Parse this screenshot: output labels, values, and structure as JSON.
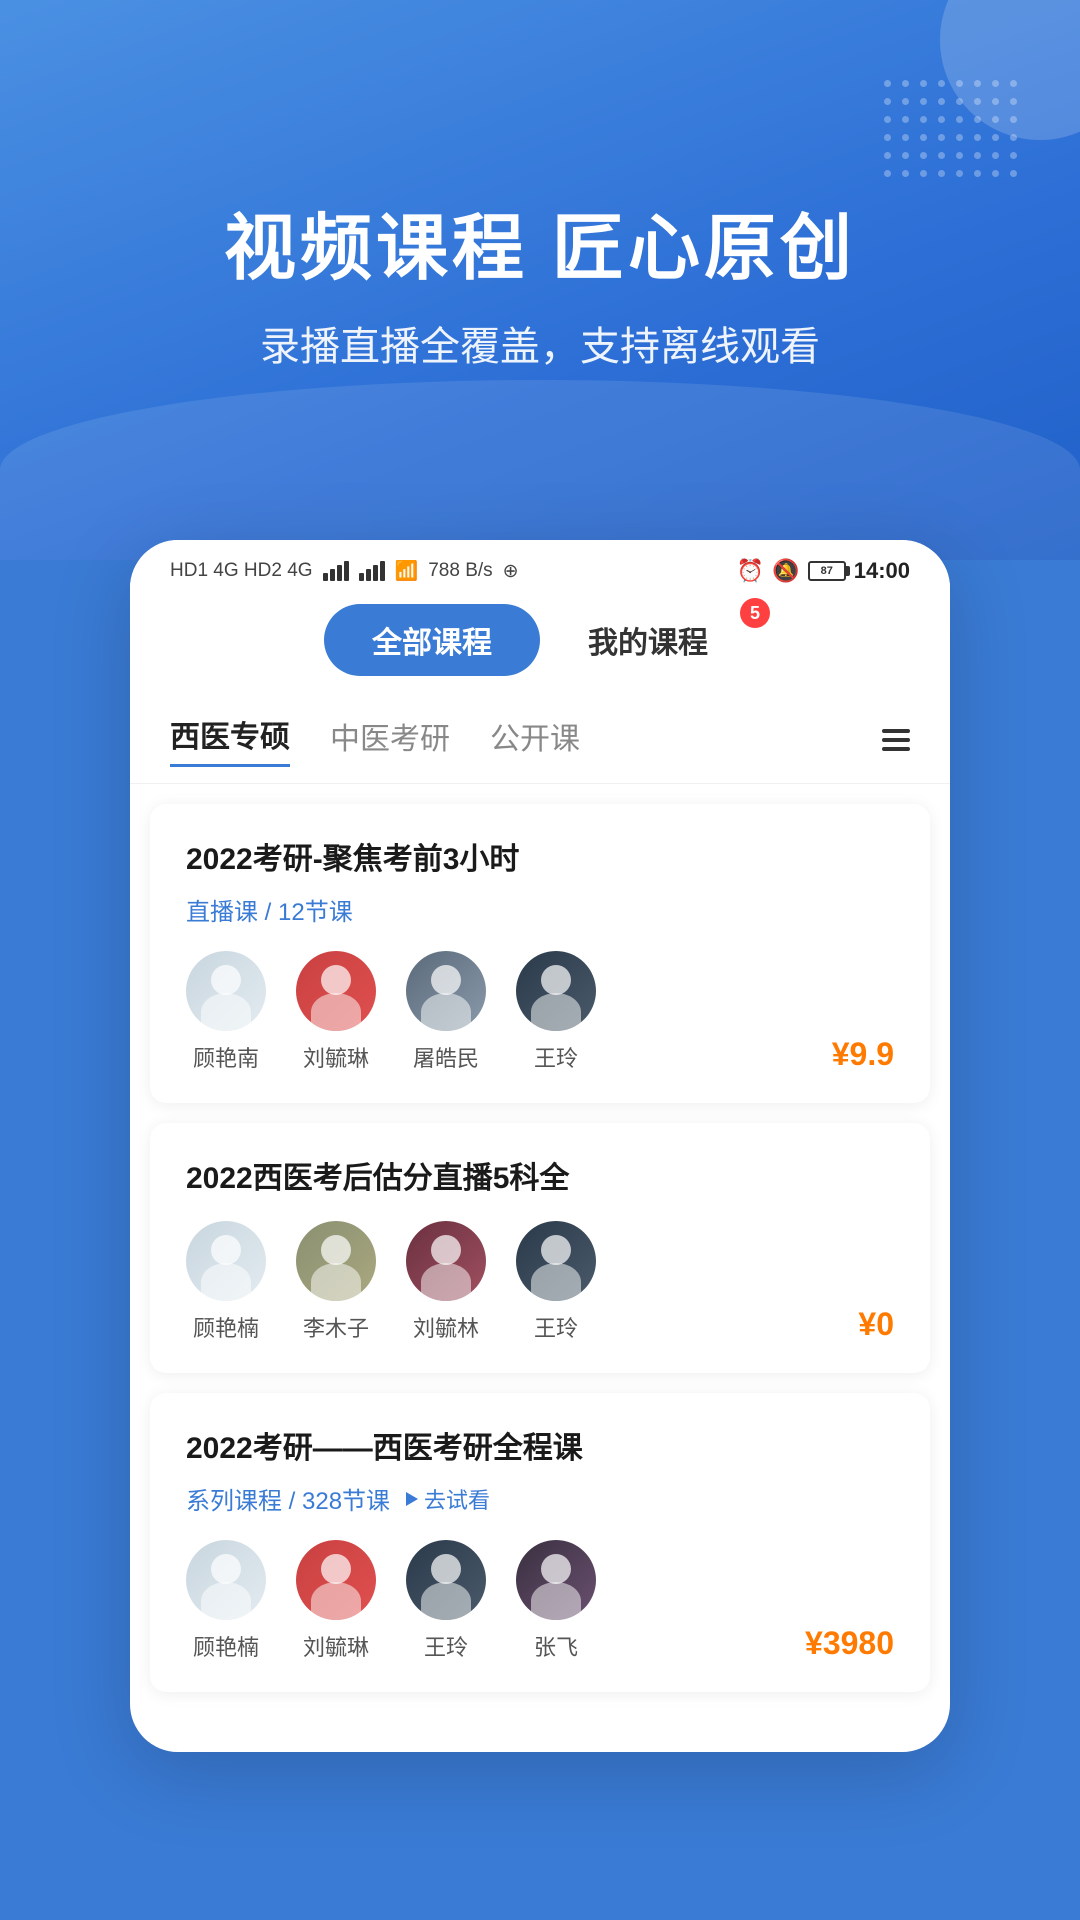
{
  "hero": {
    "title": "视频课程 匠心原创",
    "subtitle": "录播直播全覆盖，支持离线观看"
  },
  "statusBar": {
    "left": "HD1 4G HD2 4G 788 B/s",
    "battery": "87",
    "time": "14:00"
  },
  "tabs": {
    "all_courses": "全部课程",
    "my_courses": "我的课程",
    "badge": "5"
  },
  "categories": [
    {
      "label": "西医专硕",
      "active": true
    },
    {
      "label": "中医考研",
      "active": false
    },
    {
      "label": "公开课",
      "active": false
    }
  ],
  "courses": [
    {
      "title": "2022考研-聚焦考前3小时",
      "tag": "直播课 / 12节课",
      "teachers": [
        {
          "name": "顾艳南",
          "style": "female-1"
        },
        {
          "name": "刘毓琳",
          "style": "female-2"
        },
        {
          "name": "屠皓民",
          "style": "male-1"
        },
        {
          "name": "王玲",
          "style": "female-3"
        }
      ],
      "price": "¥9.9",
      "showTry": false
    },
    {
      "title": "2022西医考后估分直播5科全",
      "tag": "",
      "teachers": [
        {
          "name": "顾艳楠",
          "style": "female-1"
        },
        {
          "name": "李木子",
          "style": "male-2"
        },
        {
          "name": "刘毓林",
          "style": "female-4"
        },
        {
          "name": "王玲",
          "style": "female-3"
        }
      ],
      "price": "¥0",
      "showTry": false
    },
    {
      "title": "2022考研——西医考研全程课",
      "tag": "系列课程 / 328节课",
      "tryLabel": "▶ 去试看",
      "teachers": [
        {
          "name": "顾艳楠",
          "style": "female-1"
        },
        {
          "name": "刘毓琳",
          "style": "female-2"
        },
        {
          "name": "王玲",
          "style": "female-3"
        },
        {
          "name": "张飞",
          "style": "female-5"
        }
      ],
      "price": "¥3980",
      "showTry": true
    }
  ]
}
